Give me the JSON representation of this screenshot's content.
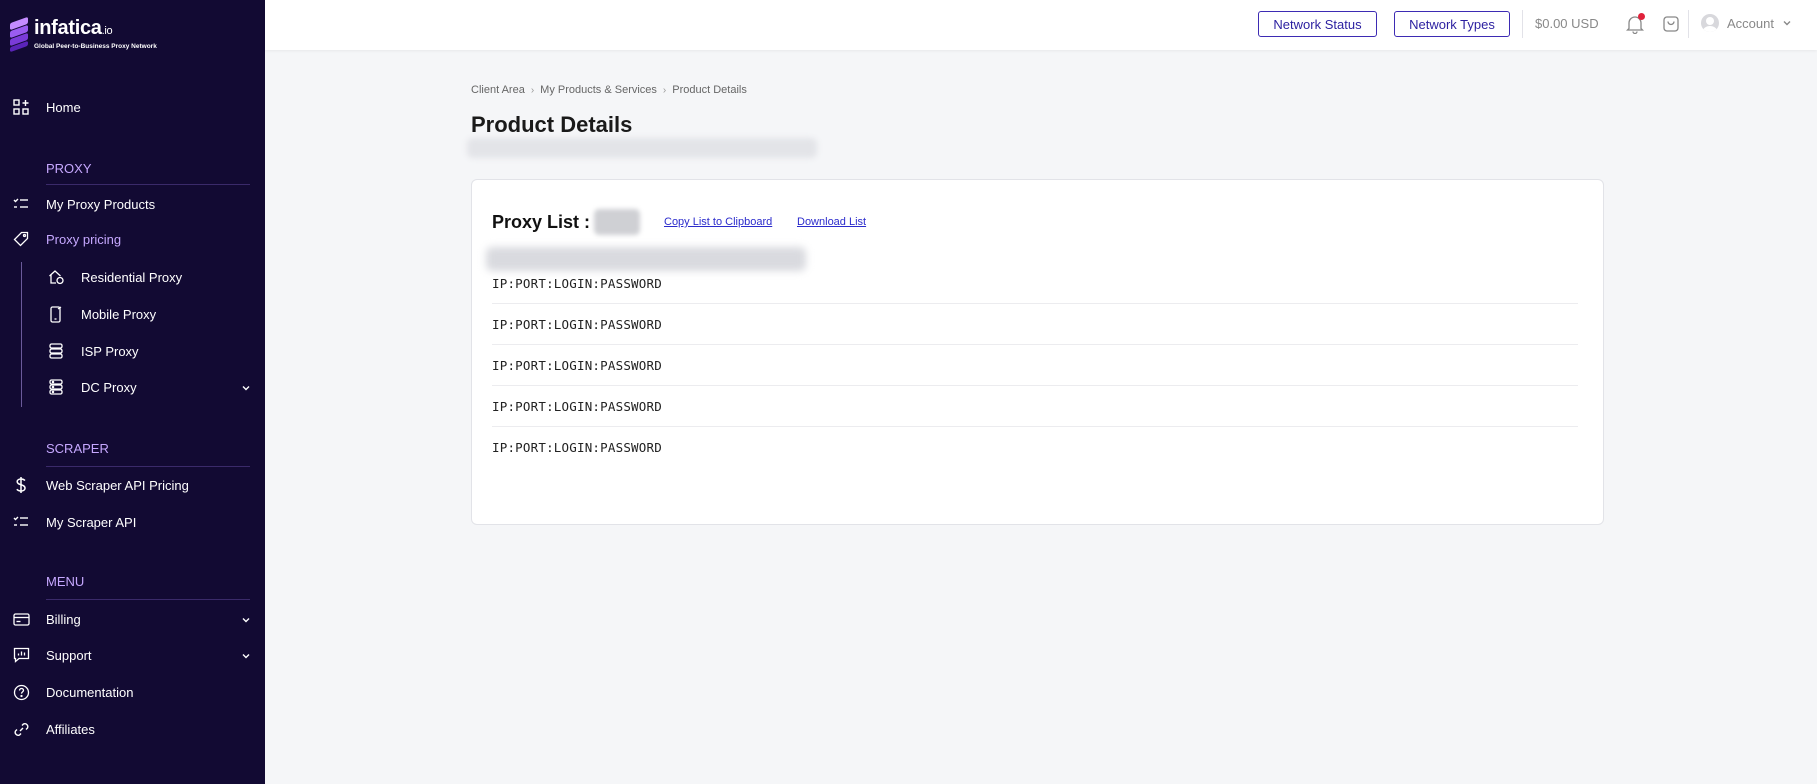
{
  "brand": {
    "name": "infatica",
    "suffix": ".io",
    "tagline": "Global Peer-to-Business Proxy Network"
  },
  "sidebar": {
    "home": "Home",
    "proxy_section": "PROXY",
    "my_proxy_products": "My Proxy Products",
    "proxy_pricing": "Proxy pricing",
    "residential": "Residential Proxy",
    "mobile": "Mobile Proxy",
    "isp": "ISP Proxy",
    "dc": "DC Proxy",
    "scraper_section": "SCRAPER",
    "web_scraper_pricing": "Web Scraper API Pricing",
    "my_scraper_api": "My Scraper API",
    "menu_section": "MENU",
    "billing": "Billing",
    "support": "Support",
    "documentation": "Documentation",
    "affiliates": "Affiliates"
  },
  "topbar": {
    "network_status": "Network Status",
    "network_types": "Network Types",
    "balance": "$0.00 USD",
    "account": "Account"
  },
  "breadcrumb": {
    "client_area": "Client Area",
    "products": "My Products & Services",
    "current": "Product Details"
  },
  "page": {
    "title": "Product Details"
  },
  "card": {
    "title": "Proxy List :",
    "copy_link": "Copy List to Clipboard",
    "download_link": "Download List",
    "rows": [
      "IP:PORT:LOGIN:PASSWORD",
      "IP:PORT:LOGIN:PASSWORD",
      "IP:PORT:LOGIN:PASSWORD",
      "IP:PORT:LOGIN:PASSWORD",
      "IP:PORT:LOGIN:PASSWORD"
    ]
  },
  "colors": {
    "sidebar_bg": "#120a33",
    "accent": "#c6a8ff",
    "button_border": "#3d2bb3",
    "link": "#2b2bcc",
    "notification": "#e0223b"
  }
}
